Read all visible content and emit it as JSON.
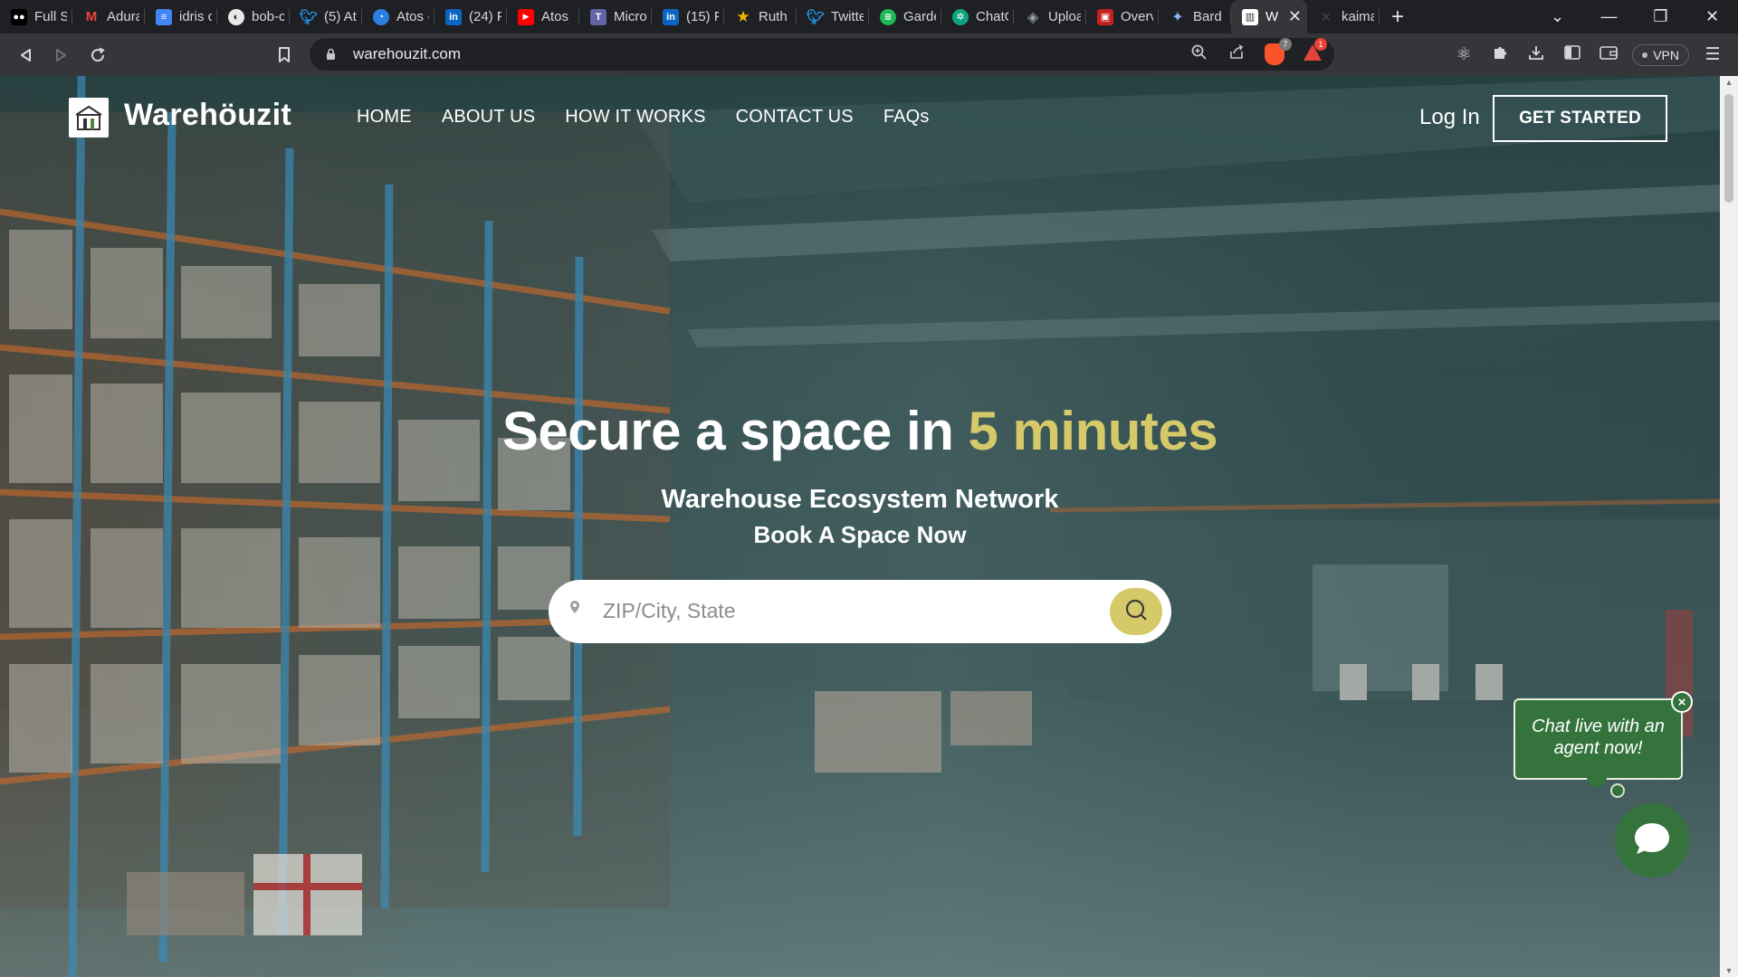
{
  "browser": {
    "tabs": [
      {
        "label": "Full St",
        "icon": "medium-icon",
        "color": "#000000"
      },
      {
        "label": "Adura",
        "icon": "gmail-icon",
        "color": "#ea4335"
      },
      {
        "label": "idris c",
        "icon": "docs-icon",
        "color": "#4285f4"
      },
      {
        "label": "bob-c",
        "icon": "github-icon",
        "color": "#555555"
      },
      {
        "label": "(5) At",
        "icon": "twitter-icon",
        "color": "#1d9bf0"
      },
      {
        "label": "Atos -",
        "icon": "atos-icon",
        "color": "#2a7de1"
      },
      {
        "label": "(24) F",
        "icon": "linkedin-icon",
        "color": "#0a66c2"
      },
      {
        "label": "Atos",
        "icon": "youtube-icon",
        "color": "#ff0000"
      },
      {
        "label": "Micro",
        "icon": "teams-icon",
        "color": "#6264a7"
      },
      {
        "label": "(15) P",
        "icon": "linkedin-icon",
        "color": "#0a66c2"
      },
      {
        "label": "Ruth",
        "icon": "star-icon",
        "color": "#f4b400"
      },
      {
        "label": "Twitte",
        "icon": "twitter-icon",
        "color": "#1d9bf0"
      },
      {
        "label": "Garde",
        "icon": "spotify-icon",
        "color": "#1db954"
      },
      {
        "label": "ChatG",
        "icon": "chatgpt-icon",
        "color": "#10a37f"
      },
      {
        "label": "Uploa",
        "icon": "stack-icon",
        "color": "#9aa0a6"
      },
      {
        "label": "Overv",
        "icon": "document-icon",
        "color": "#c5221f"
      },
      {
        "label": "Bard",
        "icon": "bard-icon",
        "color": "#8ab4f8"
      },
      {
        "label": "W",
        "icon": "warehouzit-icon",
        "color": "#ffffff",
        "active": true
      },
      {
        "label": "kaima",
        "icon": "kaima-icon",
        "color": "#222222"
      }
    ],
    "url": "warehouzit.com",
    "brave_shield_count": "7",
    "rewards_count": "1",
    "vpn_label": "VPN"
  },
  "site": {
    "logo_text": "Warehöuzit",
    "nav": [
      "HOME",
      "ABOUT US",
      "HOW IT WORKS",
      "CONTACT US",
      "FAQs"
    ],
    "login": "Log In",
    "cta": "GET STARTED"
  },
  "hero": {
    "title_main": "Secure a space in ",
    "title_highlight": "5 minutes",
    "subtitle": "Warehouse Ecosystem Network",
    "subtitle2": "Book A Space Now",
    "search_placeholder": "ZIP/City, State",
    "search_value": ""
  },
  "chat": {
    "bubble_text": "Chat live with an agent now!",
    "close_label": "×"
  },
  "colors": {
    "accent_gold": "#d6c96a",
    "chat_green": "#34743c",
    "browser_dark": "#1f2023"
  }
}
